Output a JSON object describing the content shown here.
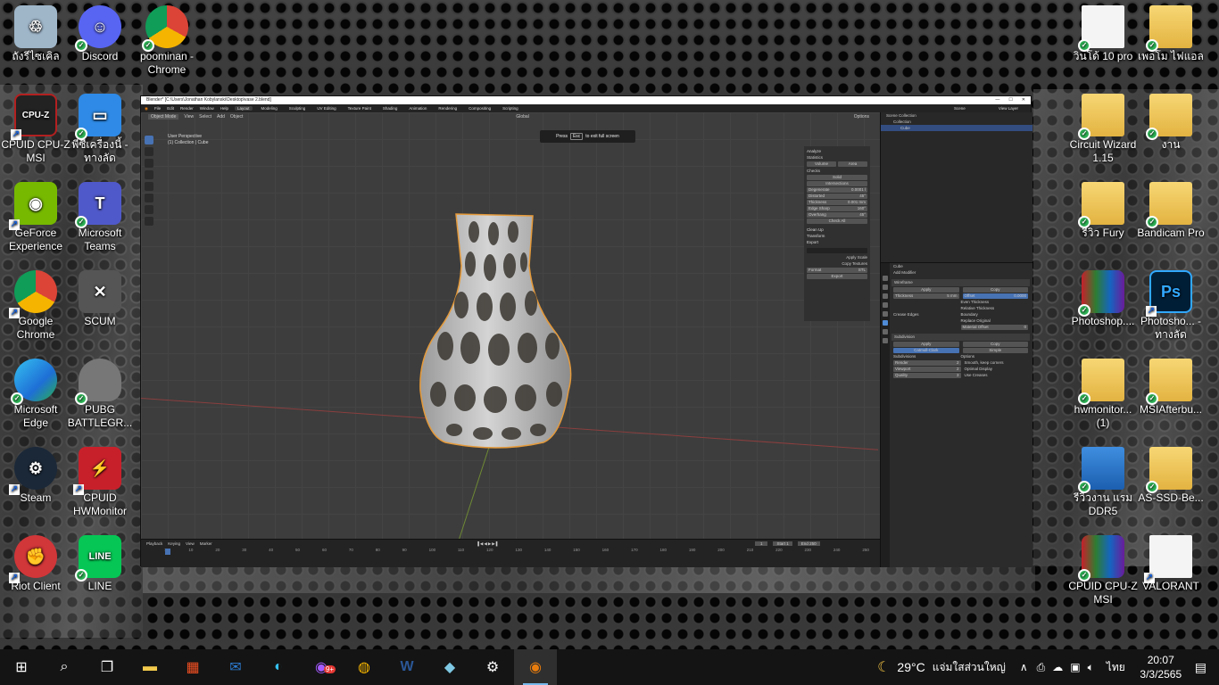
{
  "desktop": {
    "left_icons": [
      {
        "name": "recycle-bin",
        "label": "ถังรีไซเคิล",
        "color": "#9fb6c9"
      },
      {
        "name": "discord",
        "label": "Discord",
        "color": "#5865f2"
      },
      {
        "name": "chrome-profile",
        "label": "poominan - Chrome",
        "color": "#e8e8e8"
      },
      {
        "name": "cpuid-cpuz",
        "label": "CPUID CPU-Z MSI",
        "color": "#b32020"
      },
      {
        "name": "this-pc",
        "label": "พีซีเครื่องนี้ - ทางลัด",
        "color": "#2e8ae6"
      },
      {
        "name": "geforce-experience",
        "label": "GeForce Experience",
        "color": "#76b900"
      },
      {
        "name": "microsoft-teams",
        "label": "Microsoft Teams",
        "color": "#5059c9"
      },
      {
        "name": "google-chrome",
        "label": "Google Chrome",
        "color": "#e8e8e8"
      },
      {
        "name": "scum",
        "label": "SCUM",
        "color": "#555555"
      },
      {
        "name": "microsoft-edge",
        "label": "Microsoft Edge",
        "color": "#1e8ad6"
      },
      {
        "name": "pubg",
        "label": "PUBG BATTLEGR...",
        "color": "#777777"
      },
      {
        "name": "steam",
        "label": "Steam",
        "color": "#1b2838"
      },
      {
        "name": "cpuid-hwmonitor",
        "label": "CPUID HWMonitor",
        "color": "#c8202b"
      },
      {
        "name": "riot-client",
        "label": "Riot Client",
        "color": "#d13639"
      },
      {
        "name": "line",
        "label": "LINE",
        "color": "#06c755"
      }
    ],
    "right_icons": [
      {
        "name": "doc-win10",
        "label": "วินโด้ 10 pro"
      },
      {
        "name": "doc-folder-office",
        "label": "เพอโม ไฟแอล"
      },
      {
        "name": "circuit-wizard",
        "label": "Circuit Wizard 1.15"
      },
      {
        "name": "work-folder",
        "label": "งาน"
      },
      {
        "name": "review-fury",
        "label": "รีวิว Fury"
      },
      {
        "name": "bandicam-pro",
        "label": "Bandicam Pro"
      },
      {
        "name": "photoshop-rar",
        "label": "Photoshop...."
      },
      {
        "name": "photoshop-shortcut",
        "label": "Photosho... - ทางลัด"
      },
      {
        "name": "hwmonitor-folder",
        "label": "hwmonitor... (1)"
      },
      {
        "name": "msi-afterburner",
        "label": "MSIAfterbu..."
      },
      {
        "name": "review-ram-ddr5",
        "label": "รีวิวงาน แรม DDR5"
      },
      {
        "name": "as-ssd",
        "label": "AS-SSD-Be..."
      },
      {
        "name": "cpuid-cpuz-rar",
        "label": "CPUID CPU-Z MSI"
      },
      {
        "name": "valorant",
        "label": "VALORANT"
      }
    ]
  },
  "blender": {
    "title": "Blender* [C:\\Users\\Jonathan Kobylanski\\Desktop\\vase 2.blend]",
    "menus": [
      "File",
      "Edit",
      "Render",
      "Window",
      "Help"
    ],
    "workspaces": [
      "Layout",
      "Modeling",
      "Sculpting",
      "UV Editing",
      "Texture Paint",
      "Shading",
      "Animation",
      "Rendering",
      "Compositing",
      "Scripting"
    ],
    "scene_label": "Scene",
    "view_layer_label": "View Layer",
    "viewport": {
      "mode": "Object Mode",
      "menus": [
        "View",
        "Select",
        "Add",
        "Object"
      ],
      "info_line1": "User Perspective",
      "info_line2": "(1) Collection | Cube",
      "transform": "Global",
      "options": "Options",
      "hint_press": "Press",
      "hint_key": "Esc",
      "hint_text": "to exit full screen"
    },
    "npanel": {
      "analyze": "Analyze",
      "statistics": "Statistics",
      "volume": "Volume",
      "area": "Area",
      "checks": "Checks",
      "solid": "Solid",
      "intersections": "Intersections",
      "degenerate": "Degenerate",
      "degenerate_val": "0.0001 l",
      "distorted": "Distorted",
      "distorted_val": "45°",
      "thickness": "Thickness",
      "thickness_val": "0.001 mm",
      "edge_sharp": "Edge Sharp",
      "edge_sharp_val": "160°",
      "overhang": "Overhang",
      "overhang_val": "45°",
      "check_all": "Check All",
      "clean_up": "Clean Up",
      "transform": "Transform",
      "export": "Export",
      "apply_scale": "Apply Scale",
      "copy_textures": "Copy Textures",
      "format": "Format",
      "format_val": "STL",
      "export_btn": "Export"
    },
    "outliner": {
      "scene_collection": "Scene Collection",
      "collection": "Collection",
      "cube": "Cube"
    },
    "properties": {
      "object": "Cube",
      "add_modifier": "Add Modifier",
      "wireframe": "Wireframe",
      "apply": "Apply",
      "copy": "Copy",
      "thickness": "Thickness",
      "thickness_val": "5 mm",
      "offset": "Offset",
      "offset_val": "0.0000",
      "even_thickness": "Even Thickness",
      "relative_thickness": "Relative Thickness",
      "boundary": "Boundary",
      "replace_original": "Replace Original",
      "material_offset": "Material Offset",
      "material_offset_val": "0",
      "crease_edges": "Crease Edges",
      "subdivision": "Subdivision",
      "catmull_clark": "Catmull-Clark",
      "simple": "Simple",
      "subdivisions": "Subdivisions",
      "render": "Render",
      "render_val": "2",
      "viewport": "Viewport",
      "viewport_val": "2",
      "quality": "Quality",
      "quality_val": "3",
      "options": "Options",
      "smooth_keep_corners": "Smooth, keep corners",
      "optimal_display": "Optimal Display",
      "use_creases": "Use Creases"
    },
    "timeline": {
      "menus": [
        "Playback",
        "Keying",
        "View",
        "Marker"
      ],
      "frame": "1",
      "start_label": "Start",
      "start": "1",
      "end_label": "End",
      "end": "250",
      "ticks": [
        "1",
        "10",
        "20",
        "30",
        "40",
        "50",
        "60",
        "70",
        "80",
        "90",
        "100",
        "110",
        "120",
        "130",
        "140",
        "150",
        "160",
        "170",
        "180",
        "190",
        "200",
        "210",
        "220",
        "230",
        "240",
        "250"
      ]
    }
  },
  "taskbar": {
    "weather_temp": "29°C",
    "weather_text": "แจ่มใสส่วนใหญ่",
    "lang": "ไทย",
    "time": "20:07",
    "date": "3/3/2565",
    "chrome_badge": "9+"
  }
}
